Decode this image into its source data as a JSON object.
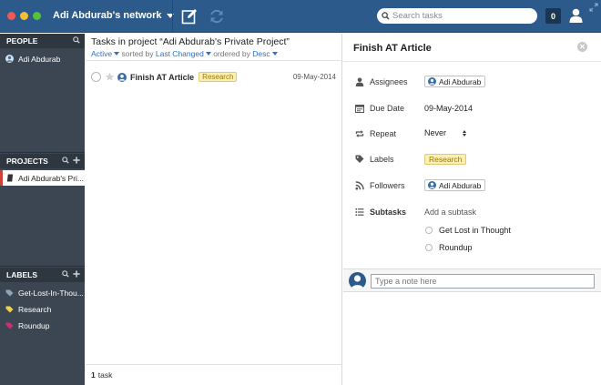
{
  "header": {
    "network_name": "Adi Abdurab's network",
    "search_placeholder": "Search tasks",
    "notification_count": "0",
    "colors": {
      "bar": "#2c5a8a",
      "accent": "#2a72c8"
    }
  },
  "sidebar": {
    "people_title": "PEOPLE",
    "people": [
      {
        "label": "Adi Abdurab"
      }
    ],
    "projects_title": "PROJECTS",
    "projects": [
      {
        "label": "Adi Abdurab's Private Project",
        "display": "Adi Abdurab's Pri..."
      }
    ],
    "labels_title": "LABELS",
    "labels": [
      {
        "label": "Get-Lost-In-Thought",
        "display": "Get-Lost-In-Thou...",
        "color": "#8fa4b8"
      },
      {
        "label": "Research",
        "display": "Research",
        "color": "#f2d14b"
      },
      {
        "label": "Roundup",
        "display": "Roundup",
        "color": "#c9306f"
      }
    ]
  },
  "task_list": {
    "title": "Tasks in project “Adi Abdurab's Private Project”",
    "filter": "Active",
    "sorted_by_text": "sorted by",
    "sort_field": "Last Changed",
    "ordered_by_text": "ordered by",
    "order": "Desc",
    "tasks": [
      {
        "title": "Finish AT Article",
        "label": "Research",
        "date": "09-May-2014"
      }
    ],
    "count": "1",
    "count_suffix": "task"
  },
  "detail": {
    "title": "Finish AT Article",
    "assignees_label": "Assignees",
    "assignee": "Adi Abdurab",
    "due_date_label": "Due Date",
    "due_date": "09-May-2014",
    "repeat_label": "Repeat",
    "repeat_value": "Never",
    "labels_label": "Labels",
    "label_value": "Research",
    "followers_label": "Followers",
    "follower": "Adi Abdurab",
    "subtasks_label": "Subtasks",
    "add_subtask": "Add a subtask",
    "subtasks": [
      "Get Lost in Thought",
      "Roundup"
    ],
    "note_placeholder": "Type a note here"
  }
}
